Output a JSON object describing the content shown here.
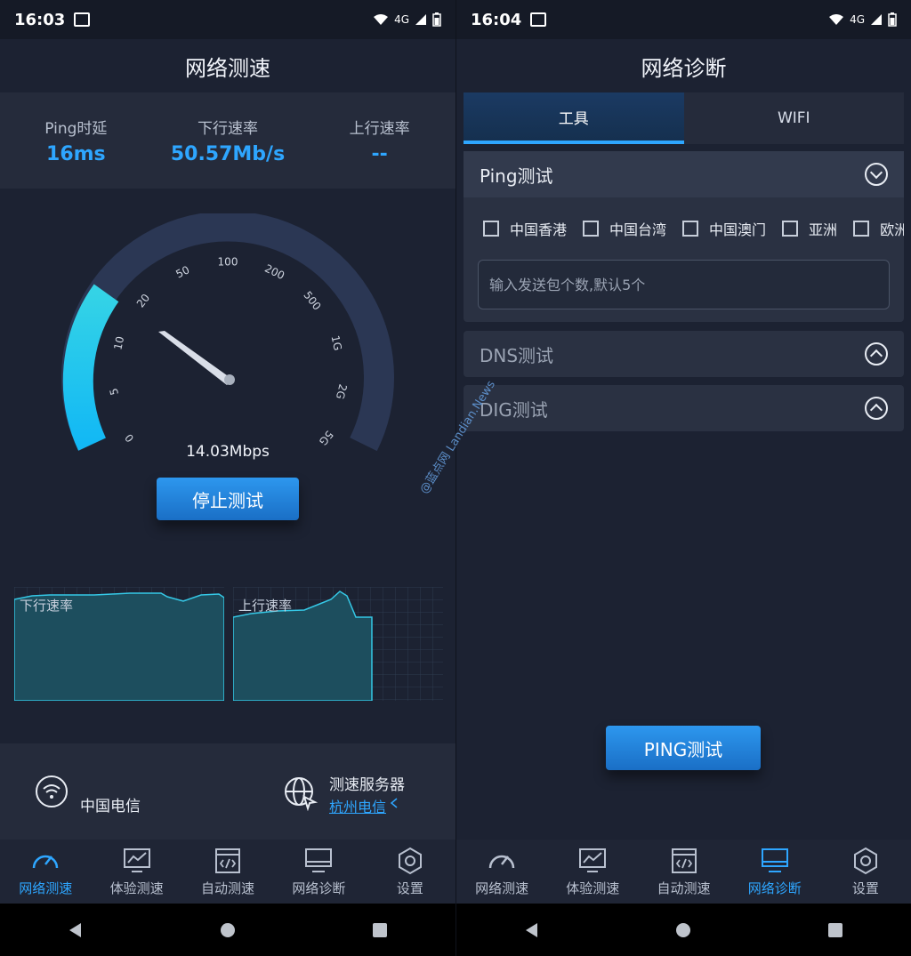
{
  "left": {
    "status": {
      "time": "16:03",
      "network": "4G"
    },
    "title": "网络测速",
    "stats": [
      {
        "label": "Ping时延",
        "value": "16ms"
      },
      {
        "label": "下行速率",
        "value": "50.57Mb/s"
      },
      {
        "label": "上行速率",
        "value": "--"
      }
    ],
    "gauge": {
      "ticks": [
        "0",
        "5",
        "10",
        "20",
        "50",
        "100",
        "200",
        "500",
        "1G",
        "2G",
        "5G"
      ],
      "current_speed": "14.03Mbps",
      "progress_fraction": 0.3
    },
    "stop_button": "停止测试",
    "charts": [
      {
        "title": "下行速率"
      },
      {
        "title": "上行速率"
      }
    ],
    "isp": "中国电信",
    "server_label": "测速服务器",
    "server_value": "杭州电信"
  },
  "right": {
    "status": {
      "time": "16:04",
      "network": "4G"
    },
    "title": "网络诊断",
    "tabs": [
      "工具",
      "WIFI"
    ],
    "ping": {
      "title": "Ping测试",
      "regions": [
        "中国香港",
        "中国台湾",
        "中国澳门",
        "亚洲",
        "欧洲"
      ],
      "input_placeholder": "输入发送包个数,默认5个"
    },
    "dns": {
      "title": "DNS测试"
    },
    "dig": {
      "title": "DIG测试"
    },
    "ping_button": "PING测试"
  },
  "nav": [
    "网络测速",
    "体验测速",
    "自动测速",
    "网络诊断",
    "设置"
  ],
  "watermark": "@蓝点网 Landian.News",
  "colors": {
    "accent": "#2ea6ff",
    "bg": "#1c2232",
    "panel": "#252b3b"
  }
}
